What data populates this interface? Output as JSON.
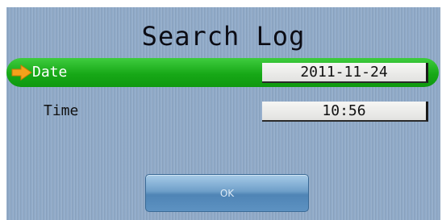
{
  "dialog": {
    "title": "Search Log"
  },
  "fields": {
    "date": {
      "label": "Date",
      "value": "2011-11-24",
      "selected": true
    },
    "time": {
      "label": "Time",
      "value": "10:56",
      "selected": false
    }
  },
  "buttons": {
    "ok_label": "OK"
  },
  "colors": {
    "background": "#90aac8",
    "selection_highlight": "#1aab1a",
    "pointer_arrow": "#f4a21b",
    "button": "#5d92c2"
  },
  "icons": {
    "selection_pointer": "right-arrow-icon"
  }
}
